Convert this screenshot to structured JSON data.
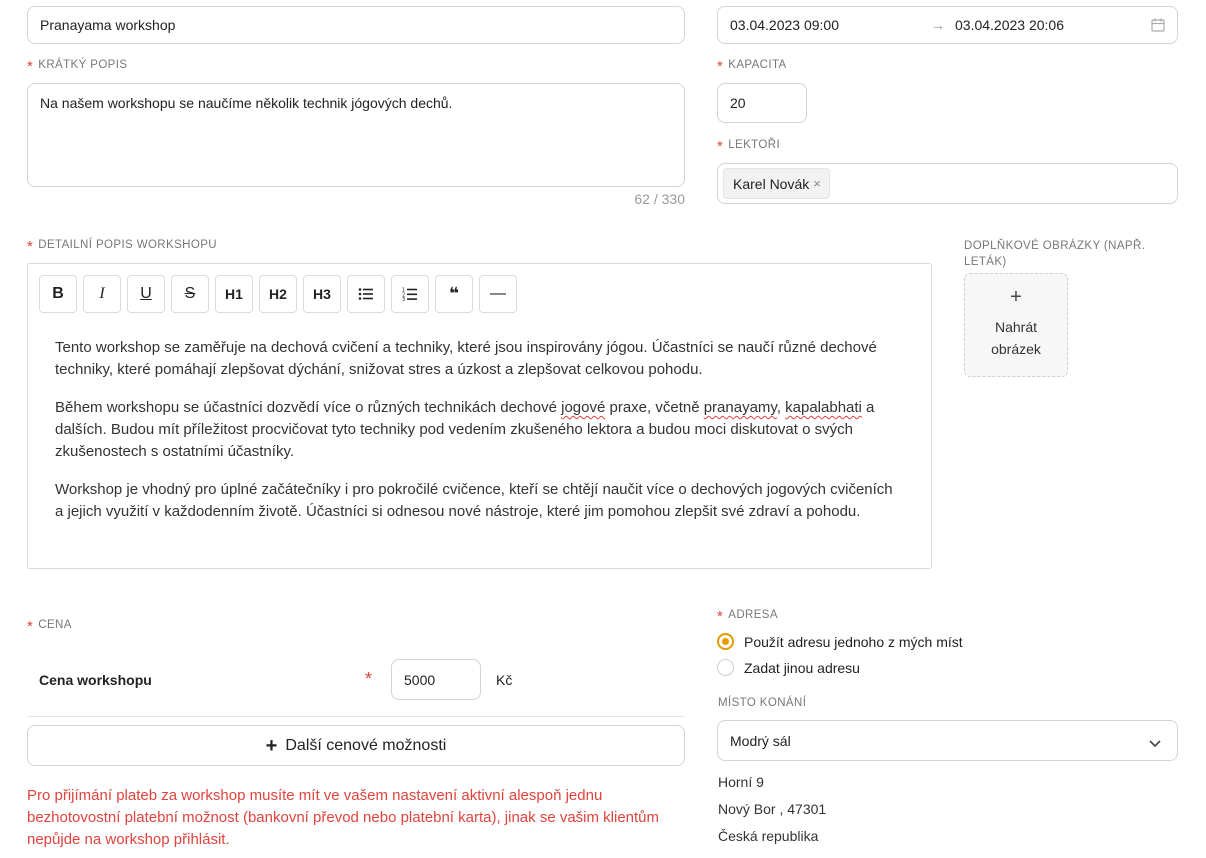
{
  "event": {
    "name": "Pranayama workshop",
    "date_start": "03.04.2023 09:00",
    "date_end": "03.04.2023 20:06",
    "date_arrow": "→",
    "calendar_icon": "calendar-icon"
  },
  "short_desc": {
    "label": "KRÁTKÝ POPIS",
    "value": "Na našem workshopu se naučíme několik technik jógových dechů.",
    "counter": "62 / 330"
  },
  "capacity": {
    "label": "KAPACITA",
    "value": "20"
  },
  "lecturers": {
    "label": "LEKTOŘI",
    "tags": [
      "Karel Novák"
    ],
    "remove_glyph": "×"
  },
  "detail": {
    "label": "DETAILNÍ POPIS WORKSHOPU",
    "toolbar": {
      "bold": "B",
      "italic": "I",
      "underline": "U",
      "strike": "S",
      "h1": "H1",
      "h2": "H2",
      "h3": "H3",
      "bullet_icon": "bullet-list-icon",
      "ordered_icon": "ordered-list-icon",
      "quote": "❝",
      "hr": "—"
    },
    "p1": "Tento workshop se zaměřuje na dechová cvičení a techniky, které jsou inspirovány jógou. Účastníci se naučí různé dechové techniky, které pomáhají zlepšovat dýchání, snižovat stres a úzkost a zlepšovat celkovou pohodu.",
    "p2_a": "Během workshopu se účastníci dozvědí více o různých technikách dechové ",
    "p2_w1": "jogové",
    "p2_b": " praxe, včetně ",
    "p2_w2": "pranayamy",
    "p2_c": ", ",
    "p2_w3": "kapalabhati",
    "p2_d": " a dalších. Budou mít příležitost procvičovat tyto techniky pod vedením zkušeného lektora a budou moci diskutovat o svých zkušenostech s ostatními účastníky.",
    "p3": "Workshop je vhodný pro úplné začátečníky i pro pokročilé cvičence, kteří se chtějí naučit více o dechových jogových cvičeních a jejich využití v každodenním životě. Účastníci si odnesou nové nástroje, které jim pomohou zlepšit své zdraví a pohodu."
  },
  "images": {
    "label": "DOPLŇKOVÉ OBRÁZKY (NAPŘ. LETÁK)",
    "upload_plus": "+",
    "upload_label": "Nahrát obrázek"
  },
  "price": {
    "label": "CENA",
    "row_label": "Cena workshopu",
    "value": "5000",
    "currency": "Kč",
    "more_plus": "+",
    "more_label": "Další cenové možnosti",
    "warning": "Pro přijímání plateb za workshop musíte mít ve vašem nastavení aktivní alespoň jednu bezhotovostní platební možnost (bankovní převod nebo platební karta), jinak se vašim klientům nepůjde na workshop přihlásit."
  },
  "address": {
    "label": "ADRESA",
    "option1": "Použít adresu jednoho z mých míst",
    "option2": "Zadat jinou adresu",
    "selected": "option1",
    "venue_label": "MÍSTO KONÁNÍ",
    "venue_value": "Modrý sál",
    "line1": "Horní 9",
    "line2": "Nový Bor , 47301",
    "line3": "Česká republika"
  },
  "colors": {
    "accent": "#e39b00",
    "required": "#e0443d",
    "border": "#d4d4d4"
  }
}
